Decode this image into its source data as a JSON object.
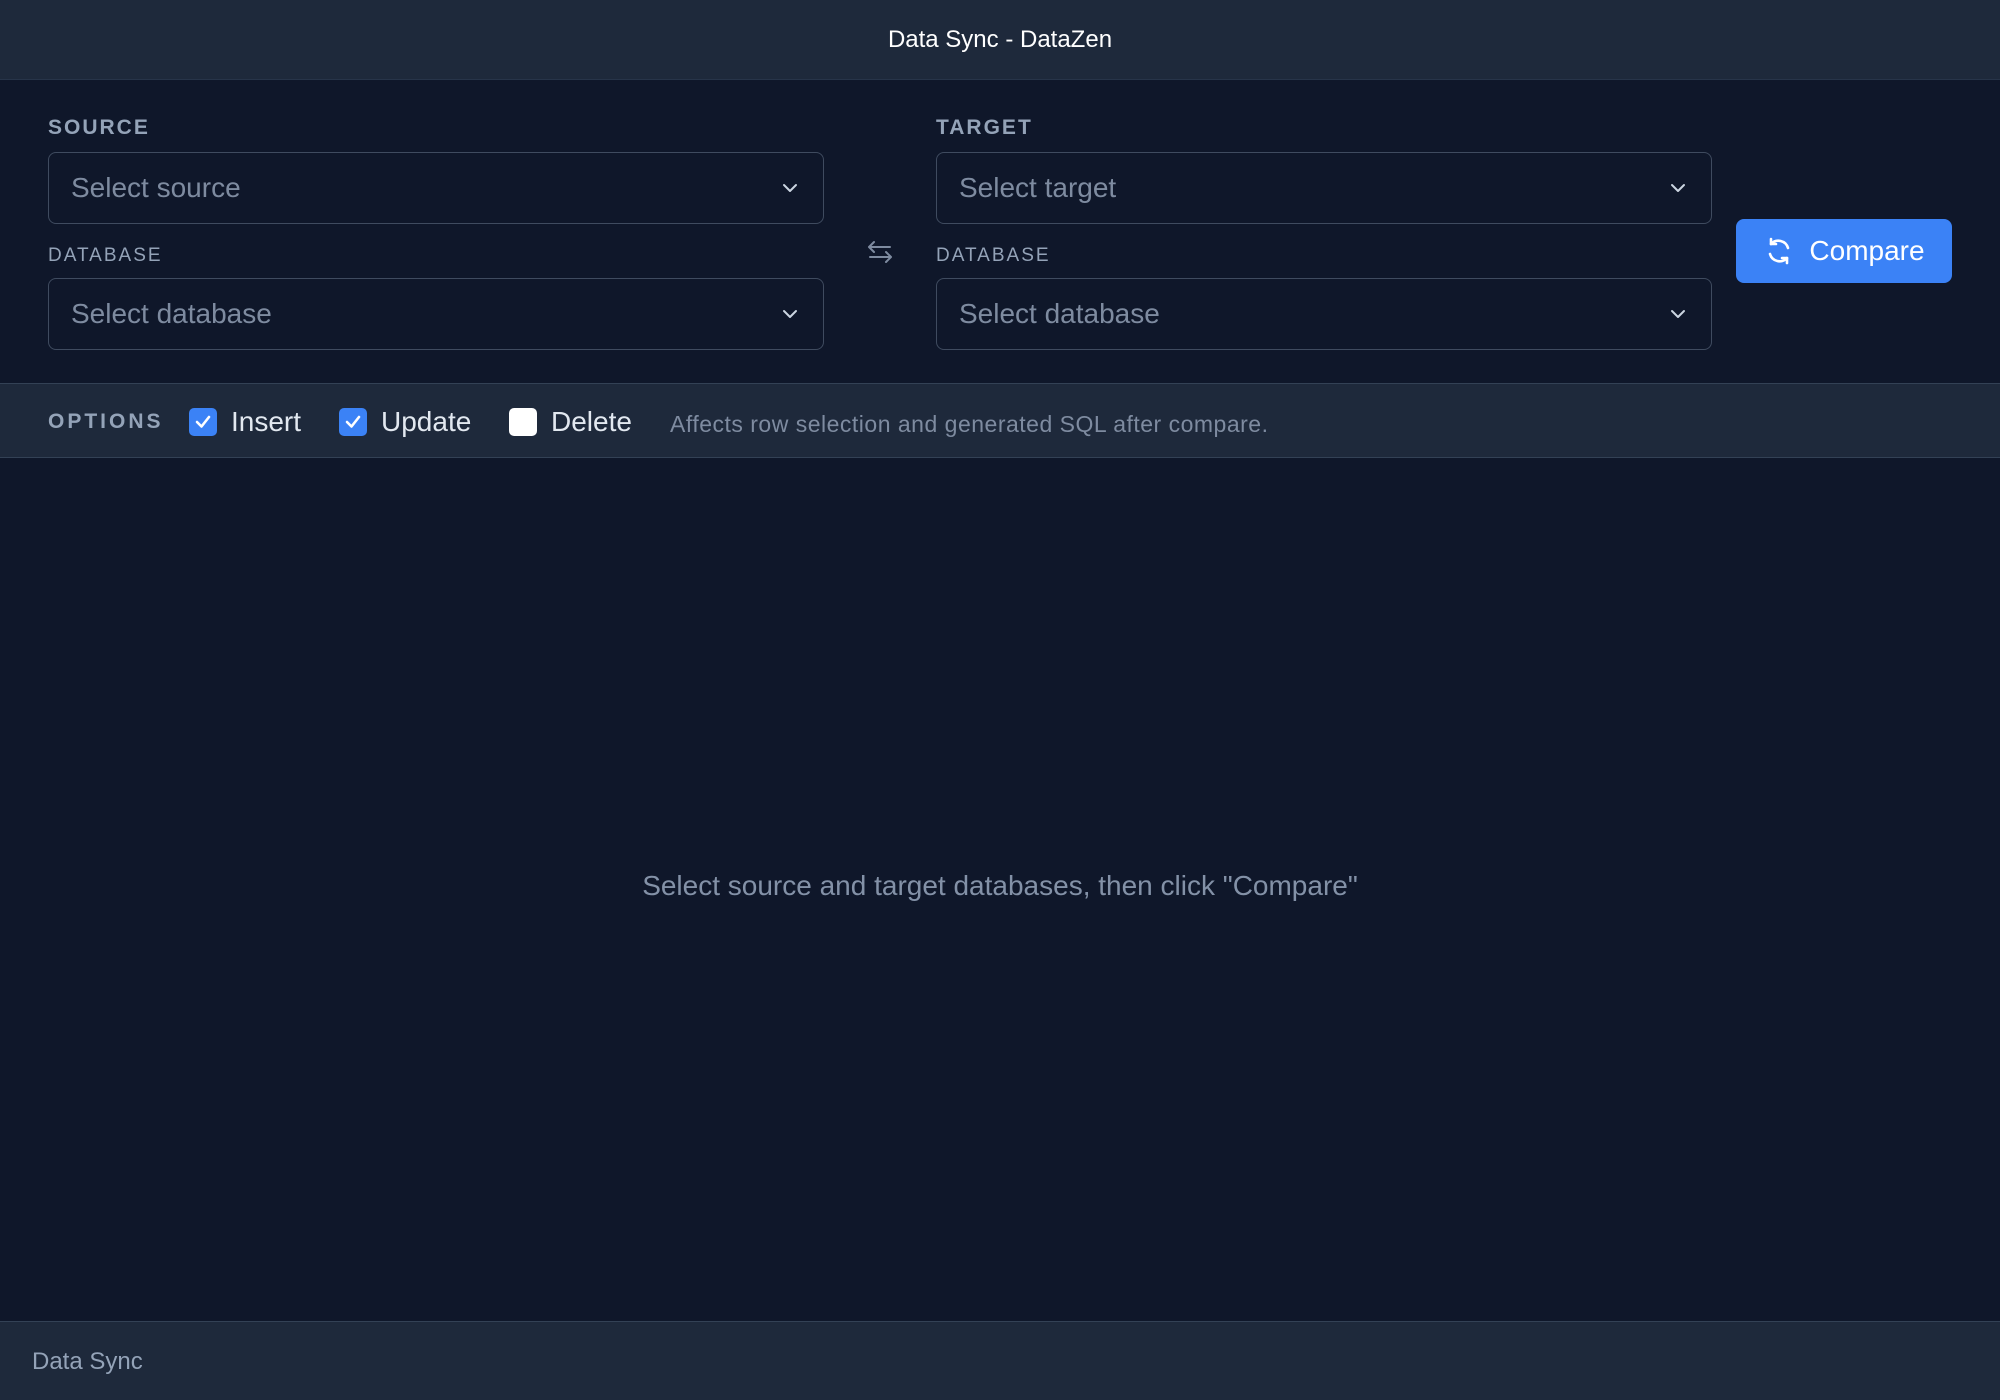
{
  "window": {
    "title": "Data Sync - DataZen"
  },
  "source": {
    "label": "SOURCE",
    "select_placeholder": "Select source",
    "database_label": "DATABASE",
    "database_placeholder": "Select database"
  },
  "target": {
    "label": "TARGET",
    "select_placeholder": "Select target",
    "database_label": "DATABASE",
    "database_placeholder": "Select database"
  },
  "compare_button": {
    "label": "Compare",
    "icon": "refresh-icon",
    "color": "#3b82f6"
  },
  "swap": {
    "icon": "swap-arrows-icon"
  },
  "options": {
    "label": "OPTIONS",
    "items": [
      {
        "label": "Insert",
        "checked": true
      },
      {
        "label": "Update",
        "checked": true
      },
      {
        "label": "Delete",
        "checked": false
      }
    ],
    "hint": "Affects row selection and generated SQL after compare."
  },
  "empty_state": {
    "message": "Select source and target databases, then click \"Compare\""
  },
  "status_bar": {
    "text": "Data Sync"
  },
  "colors": {
    "background": "#0f172a",
    "panel": "#1e293b",
    "accent": "#3b82f6"
  }
}
